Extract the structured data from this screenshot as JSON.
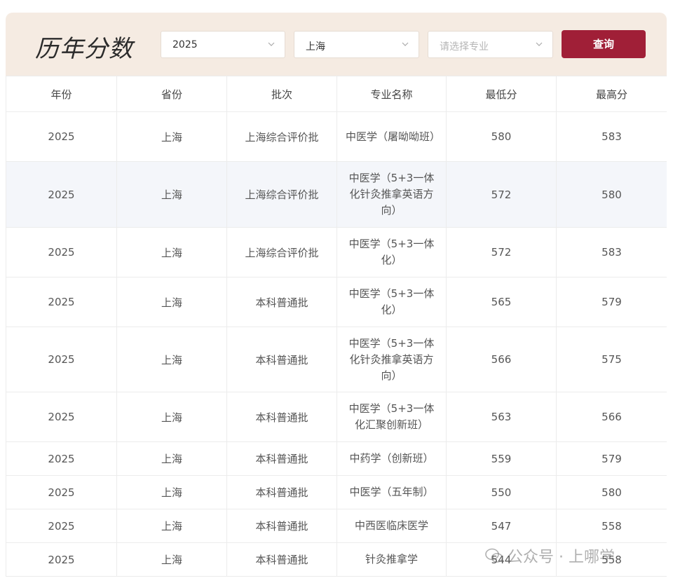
{
  "header": {
    "title": "历年分数",
    "year_select": "2025",
    "province_select": "上海",
    "major_placeholder": "请选择专业",
    "query_button": "查询"
  },
  "table": {
    "columns": [
      "年份",
      "省份",
      "批次",
      "专业名称",
      "最低分",
      "最高分"
    ],
    "rows": [
      {
        "year": "2025",
        "province": "上海",
        "batch": "上海综合评价批",
        "major": "中医学（屠呦呦班）",
        "min": "580",
        "max": "583"
      },
      {
        "year": "2025",
        "province": "上海",
        "batch": "上海综合评价批",
        "major": "中医学（5+3一体化针灸推拿英语方向）",
        "min": "572",
        "max": "580"
      },
      {
        "year": "2025",
        "province": "上海",
        "batch": "上海综合评价批",
        "major": "中医学（5+3一体化）",
        "min": "572",
        "max": "583"
      },
      {
        "year": "2025",
        "province": "上海",
        "batch": "本科普通批",
        "major": "中医学（5+3一体化）",
        "min": "565",
        "max": "579"
      },
      {
        "year": "2025",
        "province": "上海",
        "batch": "本科普通批",
        "major": "中医学（5+3一体化针灸推拿英语方向）",
        "min": "566",
        "max": "575"
      },
      {
        "year": "2025",
        "province": "上海",
        "batch": "本科普通批",
        "major": "中医学（5+3一体化汇聚创新班）",
        "min": "563",
        "max": "566"
      },
      {
        "year": "2025",
        "province": "上海",
        "batch": "本科普通批",
        "major": "中药学（创新班）",
        "min": "559",
        "max": "579"
      },
      {
        "year": "2025",
        "province": "上海",
        "batch": "本科普通批",
        "major": "中医学（五年制）",
        "min": "550",
        "max": "580"
      },
      {
        "year": "2025",
        "province": "上海",
        "batch": "本科普通批",
        "major": "中西医临床医学",
        "min": "547",
        "max": "558"
      },
      {
        "year": "2025",
        "province": "上海",
        "batch": "本科普通批",
        "major": "针灸推拿学",
        "min": "544",
        "max": "558"
      }
    ]
  },
  "watermark": "公众号 · 上哪学",
  "colors": {
    "accent": "#a01f37",
    "header_bg": "#f5ebe2",
    "alt_row": "#f4f6fa"
  }
}
